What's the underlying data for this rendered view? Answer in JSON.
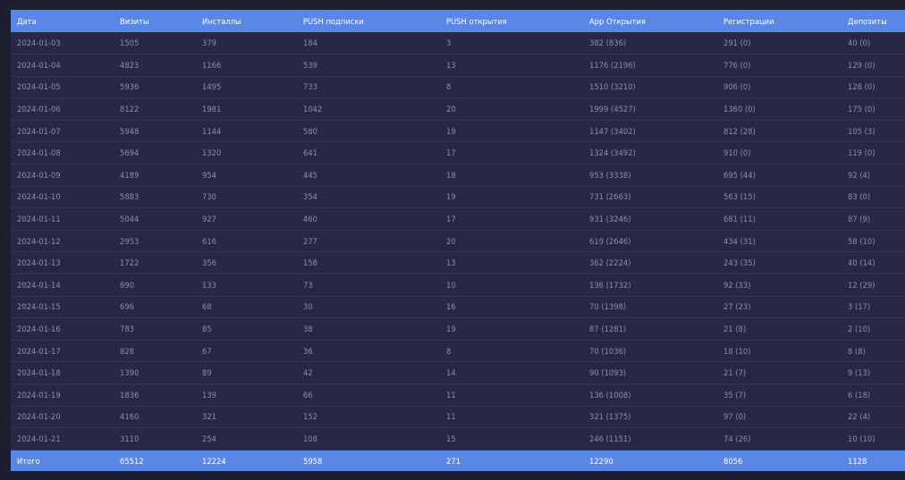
{
  "table": {
    "columns": [
      "Дата",
      "Визиты",
      "Инсталлы",
      "PUSH подписки",
      "PUSH открытия",
      "App Открытия",
      "Регистрации",
      "Депозиты"
    ],
    "rows": [
      [
        "2024-01-03",
        "1505",
        "379",
        "184",
        "3",
        "382 (836)",
        "291 (0)",
        "40 (0)"
      ],
      [
        "2024-01-04",
        "4823",
        "1166",
        "539",
        "13",
        "1176 (2196)",
        "776 (0)",
        "129 (0)"
      ],
      [
        "2024-01-05",
        "5936",
        "1495",
        "733",
        "8",
        "1510 (3210)",
        "906 (0)",
        "128 (0)"
      ],
      [
        "2024-01-06",
        "8122",
        "1981",
        "1042",
        "20",
        "1999 (4527)",
        "1360 (0)",
        "175 (0)"
      ],
      [
        "2024-01-07",
        "5948",
        "1144",
        "580",
        "19",
        "1147 (3402)",
        "812 (28)",
        "105 (3)"
      ],
      [
        "2024-01-08",
        "5694",
        "1320",
        "641",
        "17",
        "1324 (3492)",
        "910 (0)",
        "119 (0)"
      ],
      [
        "2024-01-09",
        "4189",
        "954",
        "445",
        "18",
        "953 (3338)",
        "695 (44)",
        "92 (4)"
      ],
      [
        "2024-01-10",
        "5883",
        "730",
        "354",
        "19",
        "731 (2663)",
        "563 (15)",
        "83 (0)"
      ],
      [
        "2024-01-11",
        "5044",
        "927",
        "460",
        "17",
        "931 (3246)",
        "681 (11)",
        "87 (9)"
      ],
      [
        "2024-01-12",
        "2953",
        "616",
        "277",
        "20",
        "619 (2646)",
        "434 (31)",
        "58 (10)"
      ],
      [
        "2024-01-13",
        "1722",
        "356",
        "158",
        "13",
        "362 (2224)",
        "243 (35)",
        "40 (14)"
      ],
      [
        "2024-01-14",
        "890",
        "133",
        "73",
        "10",
        "136 (1732)",
        "92 (33)",
        "12 (29)"
      ],
      [
        "2024-01-15",
        "696",
        "68",
        "30",
        "16",
        "70 (1398)",
        "27 (23)",
        "3 (17)"
      ],
      [
        "2024-01-16",
        "783",
        "85",
        "38",
        "19",
        "87 (1281)",
        "21 (8)",
        "2 (10)"
      ],
      [
        "2024-01-17",
        "828",
        "67",
        "36",
        "8",
        "70 (1036)",
        "18 (10)",
        "8 (8)"
      ],
      [
        "2024-01-18",
        "1390",
        "89",
        "42",
        "14",
        "90 (1093)",
        "21 (7)",
        "9 (13)"
      ],
      [
        "2024-01-19",
        "1836",
        "139",
        "66",
        "11",
        "136 (1008)",
        "35 (7)",
        "6 (18)"
      ],
      [
        "2024-01-20",
        "4160",
        "321",
        "152",
        "11",
        "321 (1375)",
        "97 (0)",
        "22 (4)"
      ],
      [
        "2024-01-21",
        "3110",
        "254",
        "108",
        "15",
        "246 (1151)",
        "74 (26)",
        "10 (10)"
      ]
    ],
    "total": [
      "Итого",
      "65512",
      "12224",
      "5958",
      "271",
      "12290",
      "8056",
      "1128"
    ]
  },
  "colors": {
    "background": "#1d1e30",
    "row_background": "#272843",
    "header_accent": "#5a86e8",
    "cell_text": "#8c8fab"
  }
}
